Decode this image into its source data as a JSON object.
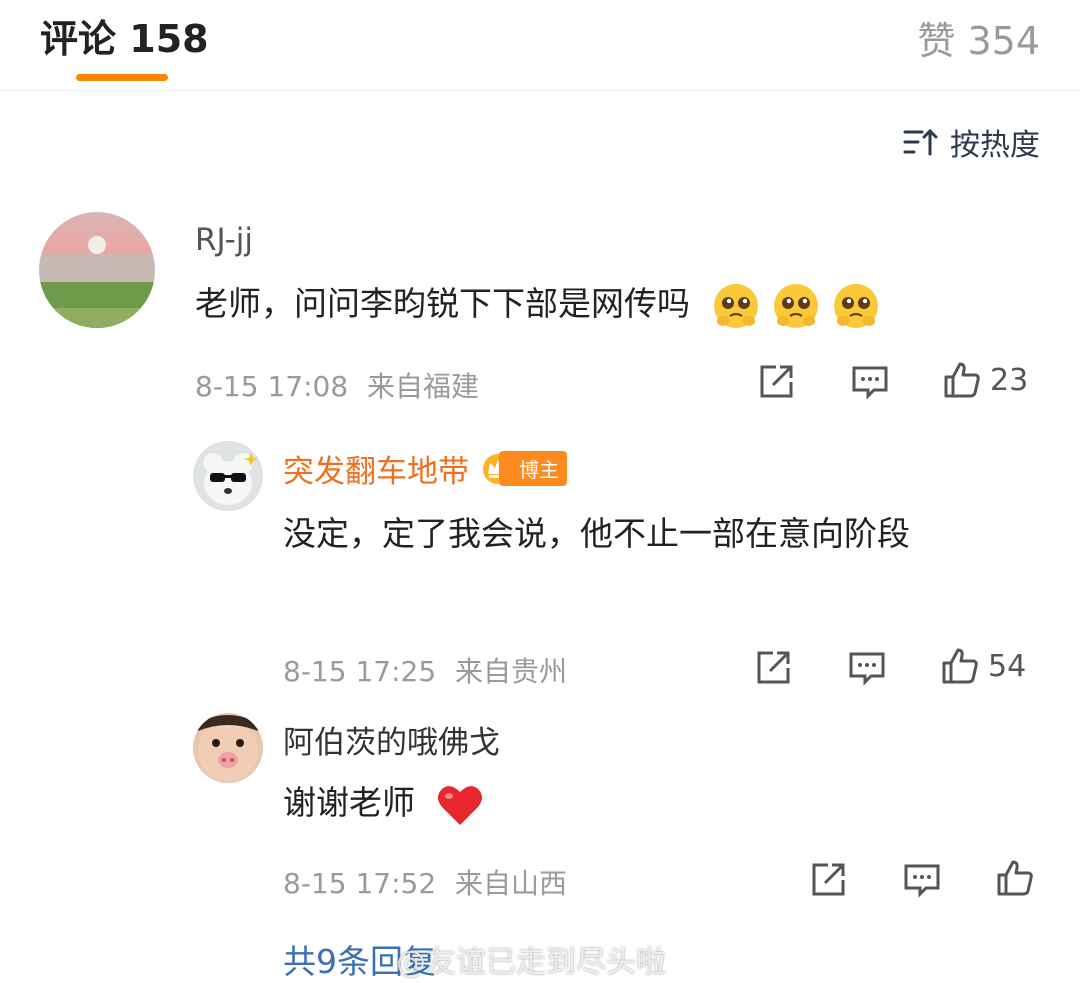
{
  "header": {
    "comments_label": "评论",
    "comments_count": "158",
    "likes_label": "赞",
    "likes_count": "354",
    "sort_label": "按热度"
  },
  "comments": [
    {
      "username": "RJ-jj",
      "text": "老师，问问李昀锐下下部是网传吗",
      "emojis": [
        "pleading-face-icon",
        "pleading-face-icon",
        "pleading-face-icon"
      ],
      "time": "8-15 17:08",
      "location": "来自福建",
      "likes": "23"
    }
  ],
  "replies": [
    {
      "username": "突发翻车地带",
      "badge": "博主",
      "text": "没定，定了我会说，他不止一部在意向阶段",
      "time": "8-15 17:25",
      "location": "来自贵州",
      "likes": "54"
    },
    {
      "username": "阿伯茨的哦佛戈",
      "text": "谢谢老师",
      "emoji": "red-heart-icon",
      "time": "8-15 17:52",
      "location": "来自山西",
      "likes": ""
    }
  ],
  "footer": {
    "more_replies": "共9条回复",
    "watermark": "@友谊已走到尽头啦"
  },
  "colors": {
    "accent": "#ff8200",
    "link": "#3a6fb5",
    "blogger_name": "#f07020",
    "meta": "#9a9a9a"
  }
}
